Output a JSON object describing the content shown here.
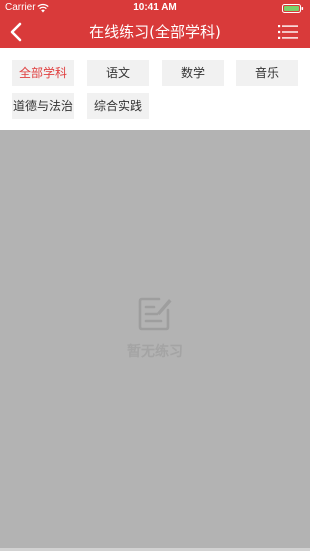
{
  "status_bar": {
    "carrier": "Carrier",
    "time": "10:41 AM",
    "icons": [
      "wifi-icon",
      "battery-icon"
    ]
  },
  "nav": {
    "title": "在线练习(全部学科)",
    "back_icon": "chevron-left-icon",
    "menu_icon": "list-menu-icon"
  },
  "filters": {
    "subjects": [
      {
        "label": "全部学科",
        "selected": true
      },
      {
        "label": "语文",
        "selected": false
      },
      {
        "label": "数学",
        "selected": false
      },
      {
        "label": "音乐",
        "selected": false
      },
      {
        "label": "道德与法治",
        "selected": false
      },
      {
        "label": "综合实践",
        "selected": false
      }
    ]
  },
  "empty_state": {
    "icon": "edit-note-icon",
    "text": "暂无练习"
  },
  "colors": {
    "brand": "#d93a3a",
    "selected_text": "#e04040",
    "chip_bg": "#f1f1f1",
    "overlay": "#b3b3b3"
  }
}
